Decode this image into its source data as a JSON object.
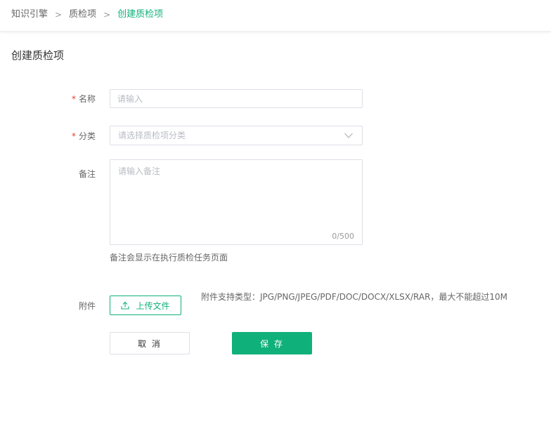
{
  "breadcrumb": {
    "items": [
      "知识引擎",
      "质检项",
      "创建质检项"
    ],
    "separator": ">"
  },
  "page": {
    "title": "创建质检项"
  },
  "form": {
    "name": {
      "label": "名称",
      "required_mark": "*",
      "value": "",
      "placeholder": "请输入"
    },
    "category": {
      "label": "分类",
      "required_mark": "*",
      "value": "",
      "placeholder": "请选择质检项分类"
    },
    "remark": {
      "label": "备注",
      "value": "",
      "placeholder": "请输入备注",
      "counter": "0/500",
      "hint": "备注会显示在执行质检任务页面"
    },
    "attachment": {
      "label": "附件",
      "upload_label": "上传文件",
      "note": "附件支持类型：JPG/PNG/JPEG/PDF/DOC/DOCX/XLSX/RAR，最大不能超过10M"
    }
  },
  "actions": {
    "cancel_label": "取 消",
    "save_label": "保 存"
  },
  "icons": {
    "select_arrow": "chevron-down-icon",
    "upload": "upload-icon"
  },
  "colors": {
    "accent": "#10b07a",
    "required": "#e23b3b",
    "border": "#dcdfe6",
    "placeholder": "#b8bcc4"
  }
}
